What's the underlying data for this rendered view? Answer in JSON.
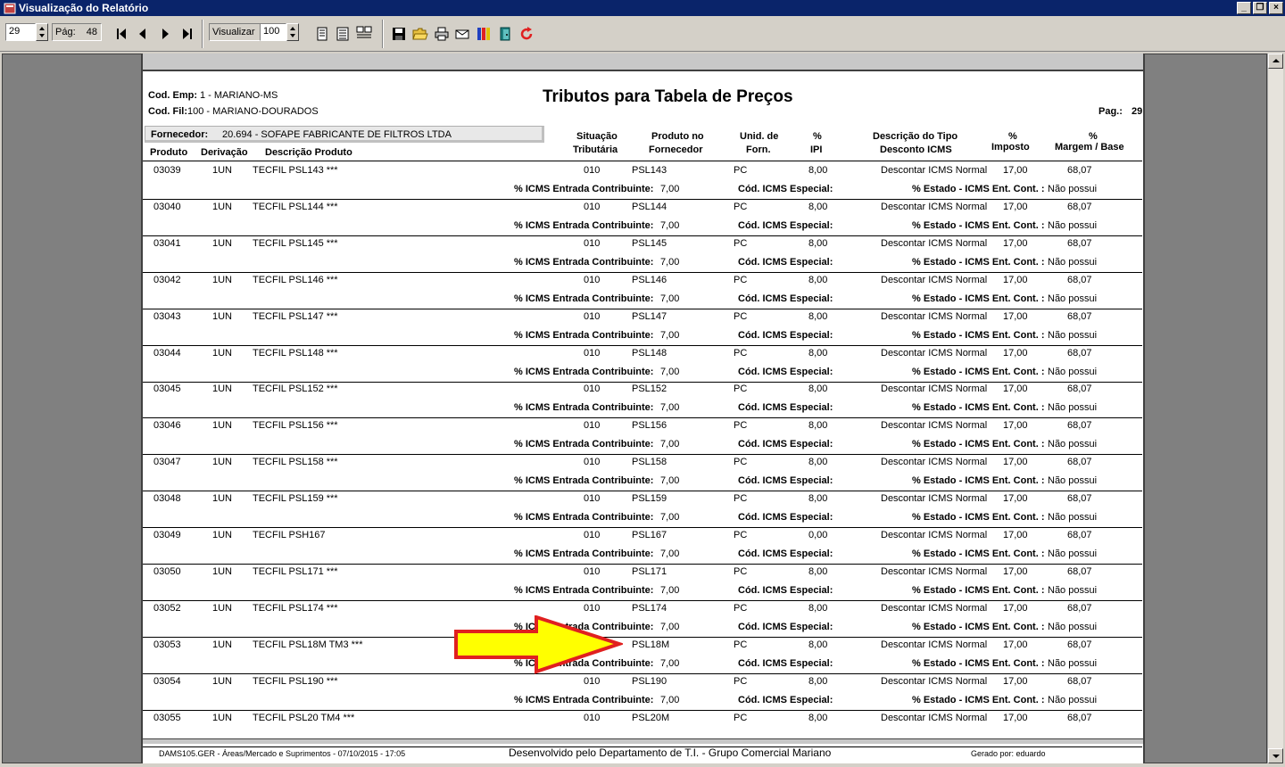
{
  "window": {
    "title": "Visualização do Relatório",
    "buttons": [
      "_",
      "❐",
      "×"
    ]
  },
  "toolbar": {
    "page_input": "29",
    "pag_label": "Pág:",
    "pag_total": "48",
    "view_label": "Visualizar",
    "zoom_value": "100"
  },
  "report": {
    "title": "Tributos para Tabela de Preços",
    "cod_emp_label": "Cod. Emp:",
    "cod_emp_value": "1 - MARIANO-MS",
    "cod_fil_label": "Cod. Fil:",
    "cod_fil_value": "100 - MARIANO-DOURADOS",
    "pag_label": "Pag.:",
    "pag_value": "29",
    "fornecedor_label": "Fornecedor:",
    "fornecedor_value": "20.694 - SOFAPE FABRICANTE DE FILTROS LTDA",
    "headers": {
      "produto": "Produto",
      "derivacao": "Derivação",
      "descricao": "Descrição Produto",
      "situacao_1": "Situação",
      "situacao_2": "Tributária",
      "prodforn_1": "Produto no",
      "prodforn_2": "Fornecedor",
      "unid_1": "Unid. de",
      "unid_2": "Forn.",
      "ipi_1": "%",
      "ipi_2": "IPI",
      "desc_tipo_1": "Descrição do Tipo",
      "desc_tipo_2": "Desconto ICMS",
      "imposto_1": "%",
      "imposto_2": "Imposto",
      "margem_1": "%",
      "margem_2": "Margem / Base"
    },
    "sub_labels": {
      "icms_entrada": "% ICMS Entrada Contribuinte:",
      "cod_icms": "Cód. ICMS Especial:",
      "estado_icms": "% Estado - ICMS Ent. Cont. :"
    },
    "rows": [
      {
        "produto": "03039",
        "derivacao": "1UN",
        "descricao": "TECFIL PSL143 ***",
        "situacao": "010",
        "prod_forn": "PSL143",
        "unid": "PC",
        "ipi": "8,00",
        "desc_tipo": "Descontar ICMS Normal",
        "imposto": "17,00",
        "margem": "68,07",
        "icms_entrada": "7,00",
        "estado": "Não possui"
      },
      {
        "produto": "03040",
        "derivacao": "1UN",
        "descricao": "TECFIL PSL144 ***",
        "situacao": "010",
        "prod_forn": "PSL144",
        "unid": "PC",
        "ipi": "8,00",
        "desc_tipo": "Descontar ICMS Normal",
        "imposto": "17,00",
        "margem": "68,07",
        "icms_entrada": "7,00",
        "estado": "Não possui"
      },
      {
        "produto": "03041",
        "derivacao": "1UN",
        "descricao": "TECFIL PSL145 ***",
        "situacao": "010",
        "prod_forn": "PSL145",
        "unid": "PC",
        "ipi": "8,00",
        "desc_tipo": "Descontar ICMS Normal",
        "imposto": "17,00",
        "margem": "68,07",
        "icms_entrada": "7,00",
        "estado": "Não possui"
      },
      {
        "produto": "03042",
        "derivacao": "1UN",
        "descricao": "TECFIL PSL146 ***",
        "situacao": "010",
        "prod_forn": "PSL146",
        "unid": "PC",
        "ipi": "8,00",
        "desc_tipo": "Descontar ICMS Normal",
        "imposto": "17,00",
        "margem": "68,07",
        "icms_entrada": "7,00",
        "estado": "Não possui"
      },
      {
        "produto": "03043",
        "derivacao": "1UN",
        "descricao": "TECFIL PSL147 ***",
        "situacao": "010",
        "prod_forn": "PSL147",
        "unid": "PC",
        "ipi": "8,00",
        "desc_tipo": "Descontar ICMS Normal",
        "imposto": "17,00",
        "margem": "68,07",
        "icms_entrada": "7,00",
        "estado": "Não possui"
      },
      {
        "produto": "03044",
        "derivacao": "1UN",
        "descricao": "TECFIL PSL148 ***",
        "situacao": "010",
        "prod_forn": "PSL148",
        "unid": "PC",
        "ipi": "8,00",
        "desc_tipo": "Descontar ICMS Normal",
        "imposto": "17,00",
        "margem": "68,07",
        "icms_entrada": "7,00",
        "estado": "Não possui"
      },
      {
        "produto": "03045",
        "derivacao": "1UN",
        "descricao": "TECFIL PSL152 ***",
        "situacao": "010",
        "prod_forn": "PSL152",
        "unid": "PC",
        "ipi": "8,00",
        "desc_tipo": "Descontar ICMS Normal",
        "imposto": "17,00",
        "margem": "68,07",
        "icms_entrada": "7,00",
        "estado": "Não possui"
      },
      {
        "produto": "03046",
        "derivacao": "1UN",
        "descricao": "TECFIL PSL156 ***",
        "situacao": "010",
        "prod_forn": "PSL156",
        "unid": "PC",
        "ipi": "8,00",
        "desc_tipo": "Descontar ICMS Normal",
        "imposto": "17,00",
        "margem": "68,07",
        "icms_entrada": "7,00",
        "estado": "Não possui"
      },
      {
        "produto": "03047",
        "derivacao": "1UN",
        "descricao": "TECFIL PSL158 ***",
        "situacao": "010",
        "prod_forn": "PSL158",
        "unid": "PC",
        "ipi": "8,00",
        "desc_tipo": "Descontar ICMS Normal",
        "imposto": "17,00",
        "margem": "68,07",
        "icms_entrada": "7,00",
        "estado": "Não possui"
      },
      {
        "produto": "03048",
        "derivacao": "1UN",
        "descricao": "TECFIL PSL159 ***",
        "situacao": "010",
        "prod_forn": "PSL159",
        "unid": "PC",
        "ipi": "8,00",
        "desc_tipo": "Descontar ICMS Normal",
        "imposto": "17,00",
        "margem": "68,07",
        "icms_entrada": "7,00",
        "estado": "Não possui"
      },
      {
        "produto": "03049",
        "derivacao": "1UN",
        "descricao": "TECFIL PSH167",
        "situacao": "010",
        "prod_forn": "PSL167",
        "unid": "PC",
        "ipi": "0,00",
        "desc_tipo": "Descontar ICMS Normal",
        "imposto": "17,00",
        "margem": "68,07",
        "icms_entrada": "7,00",
        "estado": "Não possui"
      },
      {
        "produto": "03050",
        "derivacao": "1UN",
        "descricao": "TECFIL PSL171 ***",
        "situacao": "010",
        "prod_forn": "PSL171",
        "unid": "PC",
        "ipi": "8,00",
        "desc_tipo": "Descontar ICMS Normal",
        "imposto": "17,00",
        "margem": "68,07",
        "icms_entrada": "7,00",
        "estado": "Não possui"
      },
      {
        "produto": "03052",
        "derivacao": "1UN",
        "descricao": "TECFIL PSL174 ***",
        "situacao": "010",
        "prod_forn": "PSL174",
        "unid": "PC",
        "ipi": "8,00",
        "desc_tipo": "Descontar ICMS Normal",
        "imposto": "17,00",
        "margem": "68,07",
        "icms_entrada": "7,00",
        "estado": "Não possui"
      },
      {
        "produto": "03053",
        "derivacao": "1UN",
        "descricao": "TECFIL PSL18M TM3 ***",
        "situacao": "010",
        "prod_forn": "PSL18M",
        "unid": "PC",
        "ipi": "8,00",
        "desc_tipo": "Descontar ICMS Normal",
        "imposto": "17,00",
        "margem": "68,07",
        "icms_entrada": "7,00",
        "estado": "Não possui"
      },
      {
        "produto": "03054",
        "derivacao": "1UN",
        "descricao": "TECFIL PSL190 ***",
        "situacao": "010",
        "prod_forn": "PSL190",
        "unid": "PC",
        "ipi": "8,00",
        "desc_tipo": "Descontar ICMS Normal",
        "imposto": "17,00",
        "margem": "68,07",
        "icms_entrada": "7,00",
        "estado": "Não possui"
      },
      {
        "produto": "03055",
        "derivacao": "1UN",
        "descricao": "TECFIL PSL20 TM4 ***",
        "situacao": "010",
        "prod_forn": "PSL20M",
        "unid": "PC",
        "ipi": "8,00",
        "desc_tipo": "Descontar ICMS Normal",
        "imposto": "17,00",
        "margem": "68,07",
        "icms_entrada": "",
        "estado": ""
      }
    ],
    "footer": {
      "left": "DAMS105.GER - Áreas/Mercado e Suprimentos - 07/10/2015 - 17:05",
      "middle": "Desenvolvido pelo Departamento de T.I. - Grupo Comercial Mariano",
      "right": "Gerado por:  eduardo"
    }
  },
  "colors": {
    "titlebar": "#0a246a",
    "arrow_fill": "#ffff00",
    "arrow_stroke": "#e02020"
  }
}
